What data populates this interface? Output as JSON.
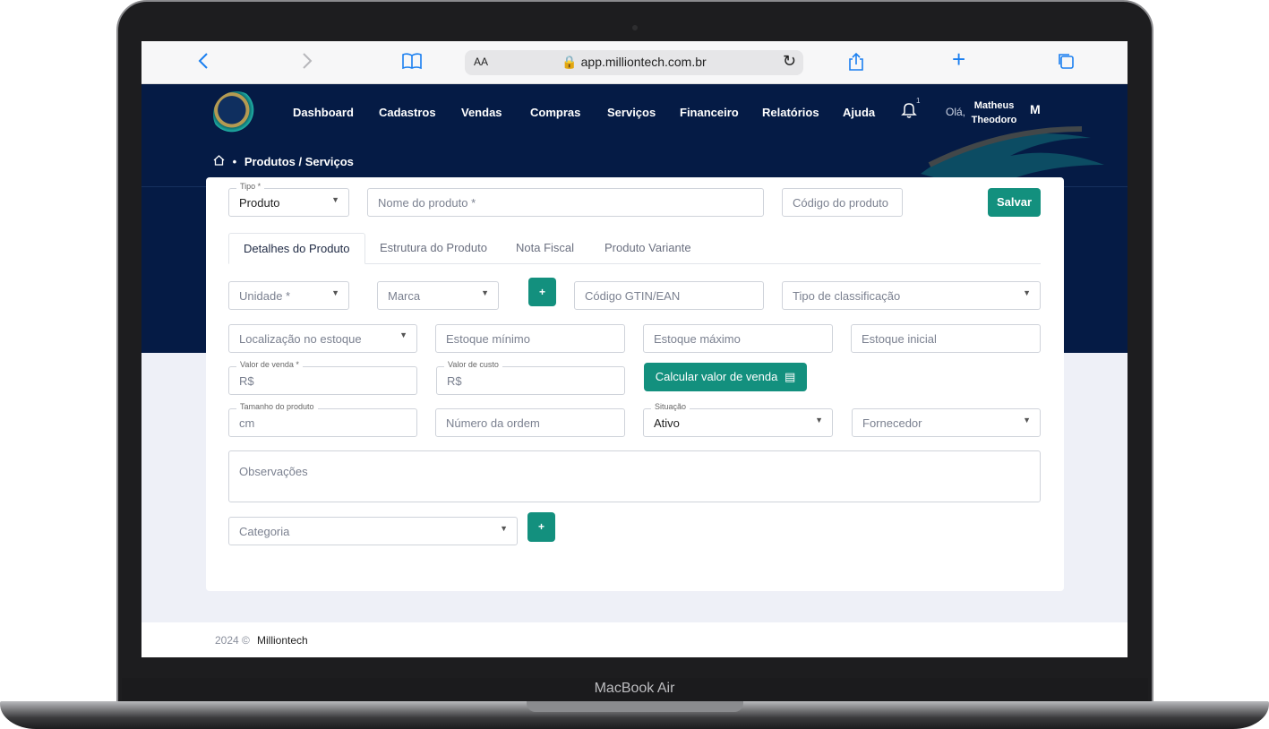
{
  "device": {
    "label": "MacBook Air"
  },
  "browser": {
    "text_size_label": "AA",
    "url": "app.milliontech.com.br"
  },
  "nav": {
    "items": [
      "Dashboard",
      "Cadastros",
      "Vendas",
      "Compras",
      "Serviços",
      "Financeiro",
      "Relatórios",
      "Ajuda"
    ],
    "notification_count": "1",
    "greeting": "Olá,",
    "user_first": "Matheus",
    "user_last": "Theodoro",
    "avatar_initial": "M"
  },
  "breadcrumb": {
    "separator": "•",
    "current": "Produtos / Serviços"
  },
  "form": {
    "tipo": {
      "label": "Tipo *",
      "value": "Produto"
    },
    "nome_placeholder": "Nome do produto *",
    "codigo_placeholder": "Código do produto",
    "save_label": "Salvar",
    "tabs": [
      "Detalhes do Produto",
      "Estrutura do Produto",
      "Nota Fiscal",
      "Produto Variante"
    ],
    "unidade_placeholder": "Unidade *",
    "marca_placeholder": "Marca",
    "add_label": "+",
    "gtin_placeholder": "Código GTIN/EAN",
    "classificacao_placeholder": "Tipo de classificação",
    "localizacao_placeholder": "Localização no estoque",
    "estoque_minimo_placeholder": "Estoque mínimo",
    "estoque_maximo_placeholder": "Estoque máximo",
    "estoque_inicial_placeholder": "Estoque inicial",
    "valor_venda": {
      "label": "Valor de venda *",
      "prefix": "R$"
    },
    "valor_custo": {
      "label": "Valor de custo",
      "prefix": "R$"
    },
    "calc_label": "Calcular valor de venda",
    "tamanho": {
      "label": "Tamanho do produto",
      "unit": "cm"
    },
    "ordem_placeholder": "Número da ordem",
    "situacao": {
      "label": "Situação",
      "value": "Ativo"
    },
    "fornecedor_placeholder": "Fornecedor",
    "observacoes_placeholder": "Observações",
    "categoria_placeholder": "Categoria"
  },
  "footer": {
    "year": "2024 ©",
    "brand": "Milliontech"
  },
  "colors": {
    "header_bg": "#051b45",
    "accent": "#13907e",
    "browser_accent": "#1a7ff0"
  }
}
